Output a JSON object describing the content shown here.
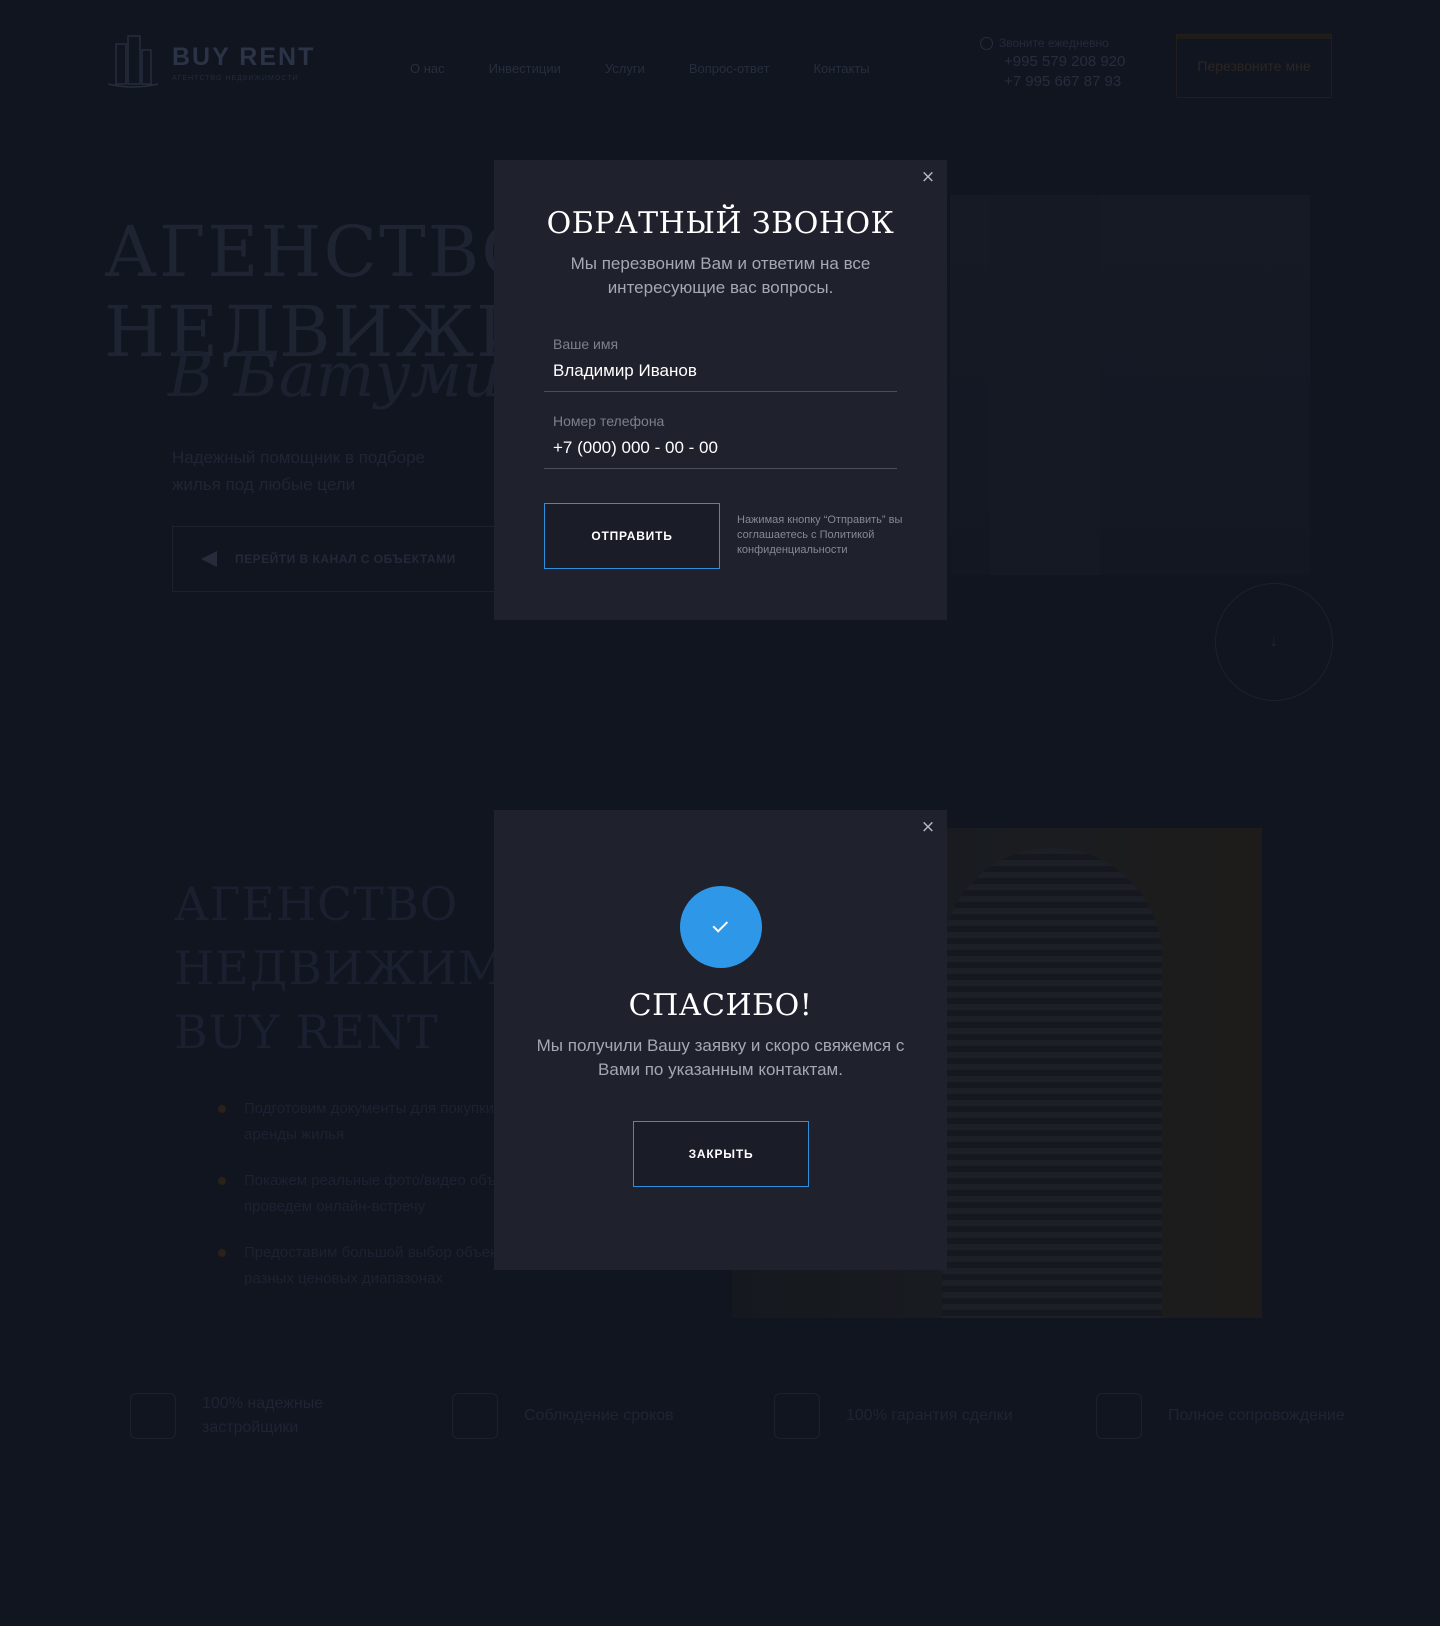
{
  "background": {
    "logo": {
      "title": "BUY RENT",
      "subtitle": "АГЕНТСТВО НЕДВИЖИМОСТИ"
    },
    "nav": [
      "О нас",
      "Инвестиции",
      "Услуги",
      "Вопрос-ответ",
      "Контакты"
    ],
    "contacts": {
      "hours": "Звоните ежедневно",
      "phone1": "+995 579 208 920",
      "phone2": "+7 995 667 87 93"
    },
    "callback_button": "Перезвоните мне",
    "hero": {
      "title_line1": "АГЕНСТВО",
      "title_line2": "НЕДВИЖИМОСТИ",
      "script": "В Батуми",
      "subtitle": "Надежный помощник в подборе жилья под любые цели",
      "telegram_button": "ПЕРЕЙТИ В КАНАЛ С ОБЪЕКТАМИ",
      "circle_arrow": "↓"
    },
    "about": {
      "title_line1": "АГЕНСТВО",
      "title_line2": "НЕДВИЖИМОСТИ",
      "title_line3": "BUY RENT",
      "items": [
        "Подготовим документы для покупки и аренды жилья",
        "Покажем реальные фото/видео объектов, проведем онлайн-встречу",
        "Предоставим большой выбор объектов в разных ценовых диапазонах"
      ]
    },
    "features": [
      {
        "icon": "buildings-icon",
        "text": "100% надежные застройщики"
      },
      {
        "icon": "calendar-icon",
        "text": "Соблюдение сроков"
      },
      {
        "icon": "document-icon",
        "text": "100% гарантия сделки"
      },
      {
        "icon": "handshake-icon",
        "text": "Полное сопровождение"
      }
    ]
  },
  "callback_modal": {
    "close_icon": "×",
    "title": "ОБРАТНЫЙ ЗВОНОК",
    "description": "Мы перезвоним Вам и ответим на все интересующие вас вопросы.",
    "name_field": {
      "label": "Ваше имя",
      "value": "Владимир Иванов"
    },
    "phone_field": {
      "label": "Номер телефона",
      "value": "+7 (000) 000 - 00 - 00"
    },
    "submit_label": "ОТПРАВИТЬ",
    "policy_text": "Нажимая кнопку “Отправить” вы соглашаетесь с Политикой конфиденциальности"
  },
  "thanks_modal": {
    "close_icon": "×",
    "check_icon": "check-icon",
    "title": "СПАСИБО!",
    "description": "Мы получили Вашу заявку и скоро свяжемся с Вами по указанным контактам.",
    "close_label": "ЗАКРЫТЬ"
  },
  "colors": {
    "page_bg": "#111520",
    "modal_bg": "#1f212d",
    "accent": "#2f97e8",
    "button_border": "#2f8fde"
  }
}
